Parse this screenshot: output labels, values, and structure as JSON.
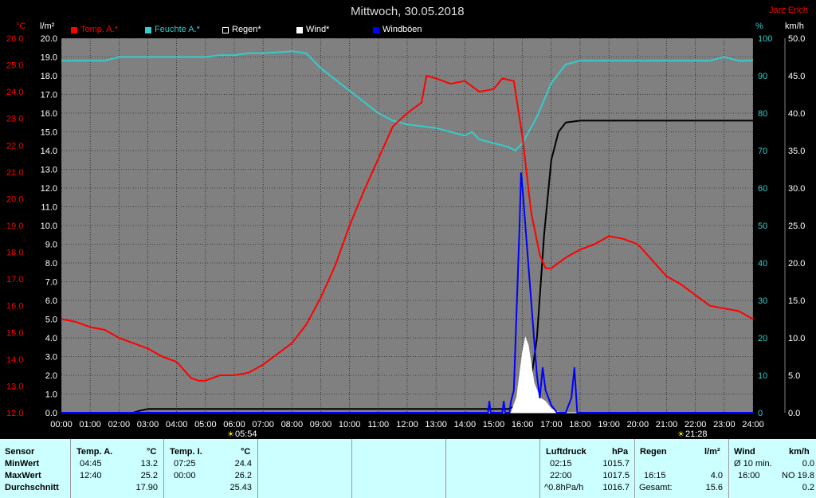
{
  "title": "Mittwoch, 30.05.2018",
  "author": "Jarz Erich",
  "colors": {
    "background": "#808080",
    "temp": "#ff0000",
    "humidity": "#33cccc",
    "rain": "#000000",
    "wind": "#ffffff",
    "gusts": "#0000ff",
    "stats_bg": "#ccffff"
  },
  "axes": {
    "temp_unit": "°C",
    "rain_unit": "l/m²",
    "hum_unit": "%",
    "wind_unit": "km/h",
    "temp_ticks": [
      "26.0",
      "25.0",
      "24.0",
      "23.0",
      "22.0",
      "21.0",
      "20.0",
      "19.0",
      "18.0",
      "17.0",
      "16.0",
      "15.0",
      "14.0",
      "13.0",
      "12.0"
    ],
    "rain_ticks": [
      "20.0",
      "19.0",
      "18.0",
      "17.0",
      "16.0",
      "15.0",
      "14.0",
      "13.0",
      "12.0",
      "11.0",
      "10.0",
      "9.0",
      "8.0",
      "7.0",
      "6.0",
      "5.0",
      "4.0",
      "3.0",
      "2.0",
      "1.0",
      "0.0"
    ],
    "hum_ticks": [
      "100",
      "90",
      "80",
      "70",
      "60",
      "50",
      "40",
      "30",
      "20",
      "10",
      "0"
    ],
    "wind_ticks": [
      "50.0",
      "45.0",
      "40.0",
      "35.0",
      "30.0",
      "25.0",
      "20.0",
      "15.0",
      "10.0",
      "5.0",
      "0.0"
    ],
    "time_ticks": [
      "00:00",
      "01:00",
      "02:00",
      "03:00",
      "04:00",
      "05:00",
      "06:00",
      "07:00",
      "08:00",
      "09:00",
      "10:00",
      "11:00",
      "12:00",
      "13:00",
      "14:00",
      "15:00",
      "16:00",
      "17:00",
      "18:00",
      "19:00",
      "20:00",
      "21:00",
      "22:00",
      "23:00",
      "24:00"
    ],
    "sunrise": "05:54",
    "sunset": "21:28"
  },
  "chart_data": {
    "type": "line",
    "x_unit": "hour",
    "xlim": [
      0,
      24
    ],
    "grid": true,
    "legend_position": "top-left",
    "series": [
      {
        "name": "Temp. A.*",
        "axis": "temp",
        "ylim": [
          12,
          26
        ],
        "points": [
          [
            0,
            15.5
          ],
          [
            0.5,
            15.4
          ],
          [
            1,
            15.2
          ],
          [
            1.5,
            15.1
          ],
          [
            2,
            14.8
          ],
          [
            2.5,
            14.6
          ],
          [
            3,
            14.4
          ],
          [
            3.5,
            14.1
          ],
          [
            4,
            13.9
          ],
          [
            4.5,
            13.3
          ],
          [
            4.75,
            13.2
          ],
          [
            5,
            13.2
          ],
          [
            5.5,
            13.4
          ],
          [
            6,
            13.4
          ],
          [
            6.5,
            13.5
          ],
          [
            7,
            13.8
          ],
          [
            7.5,
            14.2
          ],
          [
            8,
            14.6
          ],
          [
            8.5,
            15.3
          ],
          [
            9,
            16.3
          ],
          [
            9.5,
            17.5
          ],
          [
            10,
            19.0
          ],
          [
            10.5,
            20.3
          ],
          [
            11,
            21.5
          ],
          [
            11.5,
            22.7
          ],
          [
            12,
            23.2
          ],
          [
            12.5,
            23.6
          ],
          [
            12.67,
            24.6
          ],
          [
            13,
            24.5
          ],
          [
            13.5,
            24.3
          ],
          [
            14,
            24.4
          ],
          [
            14.5,
            24.0
          ],
          [
            15,
            24.1
          ],
          [
            15.3,
            24.5
          ],
          [
            15.7,
            24.4
          ],
          [
            16,
            22.3
          ],
          [
            16.3,
            19.5
          ],
          [
            16.6,
            17.9
          ],
          [
            16.8,
            17.4
          ],
          [
            17,
            17.4
          ],
          [
            17.5,
            17.8
          ],
          [
            18,
            18.1
          ],
          [
            18.5,
            18.3
          ],
          [
            19,
            18.6
          ],
          [
            19.5,
            18.5
          ],
          [
            20,
            18.3
          ],
          [
            20.5,
            17.7
          ],
          [
            21,
            17.1
          ],
          [
            21.5,
            16.8
          ],
          [
            22,
            16.4
          ],
          [
            22.5,
            16.0
          ],
          [
            23,
            15.9
          ],
          [
            23.5,
            15.8
          ],
          [
            24,
            15.5
          ]
        ]
      },
      {
        "name": "Feuchte A.*",
        "axis": "hum",
        "ylim": [
          0,
          100
        ],
        "points": [
          [
            0,
            94
          ],
          [
            1,
            94
          ],
          [
            1.5,
            94
          ],
          [
            2,
            95
          ],
          [
            3,
            95
          ],
          [
            4,
            95
          ],
          [
            5,
            95
          ],
          [
            5.5,
            95.5
          ],
          [
            6,
            95.5
          ],
          [
            6.5,
            96
          ],
          [
            7,
            96
          ],
          [
            8,
            96.5
          ],
          [
            8.5,
            96
          ],
          [
            9,
            92
          ],
          [
            9.5,
            89
          ],
          [
            10,
            86
          ],
          [
            10.5,
            83
          ],
          [
            11,
            80
          ],
          [
            11.5,
            78
          ],
          [
            12,
            77
          ],
          [
            13,
            76
          ],
          [
            14,
            74
          ],
          [
            14.25,
            75
          ],
          [
            14.5,
            73
          ],
          [
            15,
            72
          ],
          [
            15.5,
            71
          ],
          [
            15.75,
            70
          ],
          [
            16,
            72
          ],
          [
            16.5,
            79
          ],
          [
            17,
            88
          ],
          [
            17.5,
            93
          ],
          [
            18,
            94
          ],
          [
            19,
            94
          ],
          [
            20,
            94
          ],
          [
            21,
            94
          ],
          [
            22,
            94
          ],
          [
            22.5,
            94
          ],
          [
            23,
            95
          ],
          [
            23.5,
            94
          ],
          [
            24,
            94
          ]
        ]
      },
      {
        "name": "Regen*",
        "axis": "rain",
        "ylim": [
          0,
          20
        ],
        "points": [
          [
            0,
            0
          ],
          [
            2.5,
            0
          ],
          [
            2.7,
            0.1
          ],
          [
            3,
            0.2
          ],
          [
            4,
            0.2
          ],
          [
            15,
            0.2
          ],
          [
            15.5,
            0.2
          ],
          [
            16,
            0.5
          ],
          [
            16.25,
            1.2
          ],
          [
            16.5,
            4.0
          ],
          [
            16.75,
            9.5
          ],
          [
            17,
            13.5
          ],
          [
            17.25,
            15.0
          ],
          [
            17.5,
            15.5
          ],
          [
            18,
            15.6
          ],
          [
            19,
            15.6
          ],
          [
            20,
            15.6
          ],
          [
            24,
            15.6
          ]
        ]
      },
      {
        "name": "Wind*",
        "axis": "wind",
        "ylim": [
          0,
          50
        ],
        "points": [
          [
            0,
            0
          ],
          [
            15.6,
            0
          ],
          [
            15.8,
            2
          ],
          [
            16,
            8
          ],
          [
            16.1,
            10
          ],
          [
            16.2,
            9
          ],
          [
            16.4,
            4
          ],
          [
            16.6,
            2
          ],
          [
            16.8,
            1.5
          ],
          [
            17,
            0.5
          ],
          [
            17.3,
            0
          ],
          [
            24,
            0
          ]
        ]
      },
      {
        "name": "Windböen",
        "axis": "wind",
        "ylim": [
          0,
          50
        ],
        "points": [
          [
            0,
            0
          ],
          [
            14.8,
            0
          ],
          [
            14.85,
            1.5
          ],
          [
            14.9,
            0
          ],
          [
            15.3,
            0
          ],
          [
            15.35,
            1.5
          ],
          [
            15.4,
            0
          ],
          [
            15.55,
            0
          ],
          [
            15.6,
            1.5
          ],
          [
            15.7,
            3
          ],
          [
            15.8,
            14
          ],
          [
            15.9,
            25
          ],
          [
            15.95,
            32
          ],
          [
            16.0,
            30
          ],
          [
            16.1,
            25
          ],
          [
            16.2,
            20
          ],
          [
            16.3,
            15
          ],
          [
            16.4,
            10
          ],
          [
            16.5,
            5
          ],
          [
            16.6,
            2
          ],
          [
            16.7,
            6
          ],
          [
            16.8,
            3
          ],
          [
            17.0,
            1
          ],
          [
            17.2,
            0
          ],
          [
            17.5,
            0
          ],
          [
            17.7,
            2
          ],
          [
            17.8,
            6
          ],
          [
            17.85,
            3
          ],
          [
            17.9,
            0
          ],
          [
            24,
            0
          ]
        ]
      }
    ]
  },
  "stats": {
    "sensor": {
      "header": "Sensor",
      "min": "MinWert",
      "max": "MaxWert",
      "avg": "Durchschnitt"
    },
    "temp_a": {
      "header": "Temp. A.",
      "unit": "°C",
      "min_time": "04:45",
      "min_val": "13.2",
      "max_time": "12:40",
      "max_val": "25.2",
      "avg": "17.90"
    },
    "temp_i": {
      "header": "Temp. I.",
      "unit": "°C",
      "min_time": "07:25",
      "min_val": "24.4",
      "max_time": "00:00",
      "max_val": "26.2",
      "avg": "25.43"
    },
    "pressure": {
      "header": "Luftdruck",
      "unit": "hPa",
      "min_time": "02:15",
      "min_val": "1015.7",
      "max_time": "22:00",
      "max_val": "1017.5",
      "trend": "^0.8hPa/h",
      "avg": "1016.7"
    },
    "rain": {
      "header": "Regen",
      "unit": "l/m²",
      "max_time": "16:15",
      "max_val": "4.0",
      "total_label": "Gesamt:",
      "total": "15.6"
    },
    "wind": {
      "header": "Wind",
      "unit": "km/h",
      "avg_label": "Ø 10 min.",
      "avg_val": "0.0",
      "max_time": "16:00",
      "max_val": "NO 19.8",
      "avg": "0.2"
    }
  }
}
